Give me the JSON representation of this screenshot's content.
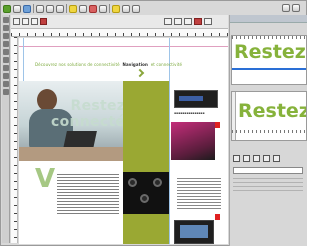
{
  "layout_header": {
    "title": "Restez",
    "subtitle": "connecté"
  },
  "header_line": {
    "text": "Découvrez nos solutions de connectivité",
    "highlight": "Navigation",
    "tail": "et connectivité"
  },
  "preview": {
    "word_top": "Restez",
    "word_bottom": "Restez"
  },
  "colors": {
    "accent_green": "#86b23b",
    "olive_band": "#9aa833",
    "guide_blue": "#2a6fd6",
    "marker_red": "#e02020"
  },
  "icons": [
    "new-doc-icon",
    "open-icon",
    "save-icon",
    "print-icon",
    "undo-icon",
    "redo-icon",
    "zoom-icon",
    "text-tool-icon",
    "image-tool-icon",
    "settings-icon"
  ]
}
